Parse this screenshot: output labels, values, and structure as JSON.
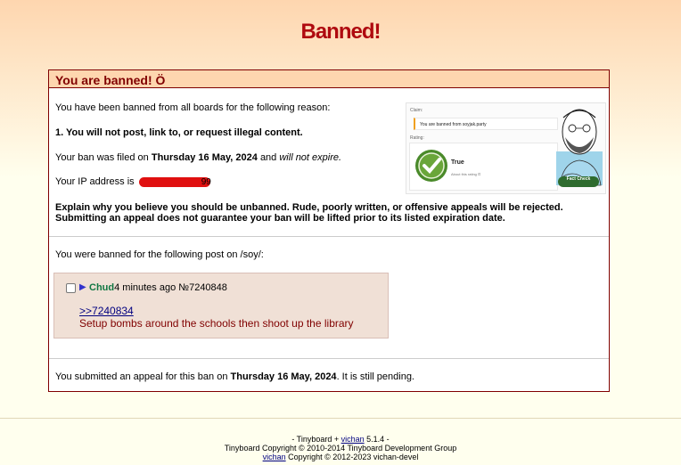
{
  "page": {
    "title": "Banned!"
  },
  "ban": {
    "header": "You are banned! Ö",
    "reason_intro": "You have been banned from all boards for the following reason:",
    "reason": "1. You will not post, link to, or request illegal content.",
    "filed_prefix": "Your ban was filed on",
    "filed_date": "Thursday 16 May, 2024",
    "filed_mid": "and",
    "filed_expire": "will not expire.",
    "ip_label": "Your IP address is",
    "ip_fragment": "99",
    "appeal_notice_line1": "Explain why you believe you should be unbanned. Rude, poorly written, or offensive appeals will be rejected.",
    "appeal_notice_line2": "Submitting an appeal does not guarantee your ban will be lifted prior to its listed expiration date.",
    "post_intro": "You were banned for the following post on /soy/:",
    "appeal_prefix": "You submitted an appeal for this ban on",
    "appeal_date": "Thursday 16 May, 2024",
    "appeal_suffix": ". It is still pending."
  },
  "fact_check": {
    "claim_label": "Claim:",
    "claim_text": "You are banned from soyjak.party",
    "rating_label": "Rating:",
    "rating": "True",
    "rated_note": "About this rating ⊡",
    "badge": "Fact Check",
    "colors": {
      "check_green": "#4a8a2a",
      "badge_green": "#2e6b2e"
    }
  },
  "post": {
    "name": "Chud",
    "time": "4 minutes ago",
    "number": "№7240848",
    "quote_link": ">>7240834",
    "body": "Setup bombs around the schools then shoot up the library"
  },
  "footer": {
    "line1_prefix": "- Tinyboard +",
    "line1_link": "vichan",
    "line1_suffix": "5.1.4 -",
    "line2": "Tinyboard Copyright © 2010-2014 Tinyboard Development Group",
    "line3_link": "vichan",
    "line3_suffix": "Copyright © 2012-2023 vichan-devel"
  }
}
